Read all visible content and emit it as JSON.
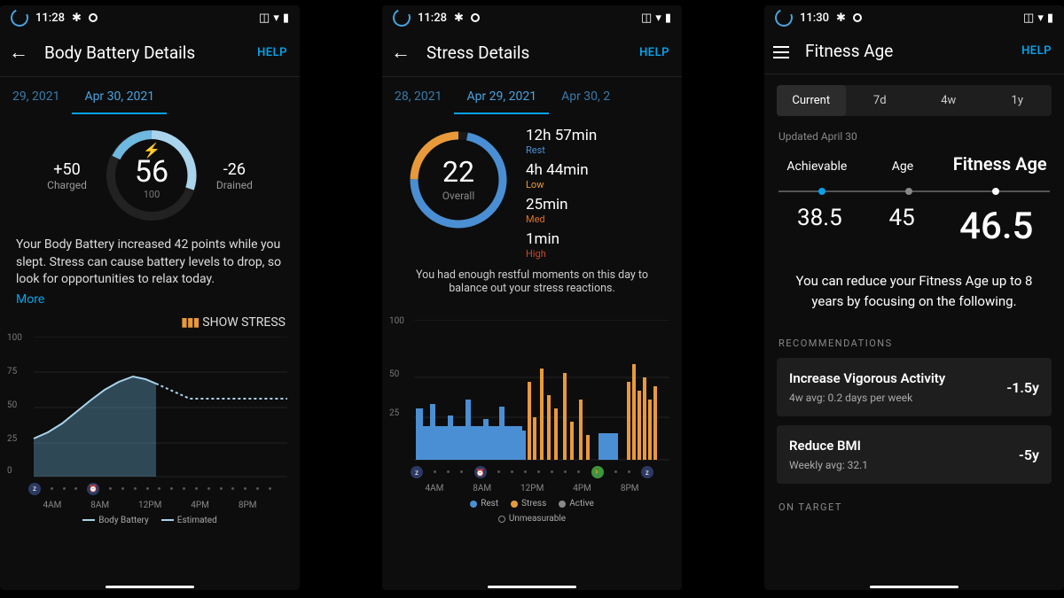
{
  "screen1": {
    "status": {
      "time": "11:28"
    },
    "title": "Body Battery Details",
    "help": "HELP",
    "date_prev": "29, 2021",
    "date_active": "Apr 30, 2021",
    "charged_label": "Charged",
    "charged_value": "+50",
    "drained_label": "Drained",
    "drained_value": "-26",
    "main_value": "56",
    "max_value": "100",
    "description": "Your Body Battery increased 42 points while you slept. Stress can cause battery levels to drop, so look for opportunities to relax today.",
    "more": "More",
    "show_stress": "SHOW STRESS",
    "xlabels": [
      "4AM",
      "8AM",
      "12PM",
      "4PM",
      "8PM"
    ],
    "legend1": "Body Battery",
    "legend2": "Estimated"
  },
  "screen2": {
    "status": {
      "time": "11:28"
    },
    "title": "Stress Details",
    "help": "HELP",
    "date_prev": "28, 2021",
    "date_active": "Apr 29, 2021",
    "date_next": "Apr 30, 2",
    "main_value": "22",
    "main_label": "Overall",
    "stats": [
      {
        "value": "12h 57min",
        "label": "Rest",
        "cls": "c-rest"
      },
      {
        "value": "4h 44min",
        "label": "Low",
        "cls": "c-low"
      },
      {
        "value": "25min",
        "label": "Med",
        "cls": "c-med"
      },
      {
        "value": "1min",
        "label": "High",
        "cls": "c-high"
      }
    ],
    "description": "You had enough restful moments on this day to balance out your stress reactions.",
    "xlabels": [
      "4AM",
      "8AM",
      "12PM",
      "4PM",
      "8PM"
    ],
    "legend": [
      "Rest",
      "Stress",
      "Active",
      "Unmeasurable"
    ]
  },
  "screen3": {
    "status": {
      "time": "11:30"
    },
    "title": "Fitness Age",
    "help": "HELP",
    "tabs": [
      "Current",
      "7d",
      "4w",
      "1y"
    ],
    "updated": "Updated April 30",
    "col1_label": "Achievable",
    "col2_label": "Age",
    "col3_label": "Fitness Age",
    "val_achievable": "38.5",
    "val_age": "45",
    "val_fitness": "46.5",
    "description": "You can reduce your Fitness Age up to 8 years by focusing on the following.",
    "section": "RECOMMENDATIONS",
    "cards": [
      {
        "title": "Increase Vigorous Activity",
        "sub": "4w avg: 0.2 days per week",
        "delta": "-1.5y"
      },
      {
        "title": "Reduce BMI",
        "sub": "Weekly avg: 32.1",
        "delta": "-5y"
      }
    ],
    "on_target": "ON TARGET"
  },
  "chart_data": [
    {
      "type": "area",
      "title": "Body Battery",
      "xlabel": "",
      "ylabel": "",
      "ylim": [
        0,
        100
      ],
      "x_hours": [
        0,
        1,
        2,
        3,
        4,
        5,
        6,
        7,
        8,
        9,
        10,
        11,
        12
      ],
      "values": [
        30,
        34,
        40,
        48,
        56,
        63,
        68,
        72,
        70,
        66,
        56,
        56,
        56
      ],
      "estimated_after_index": 9,
      "x_ticks": [
        "4AM",
        "8AM",
        "12PM",
        "4PM",
        "8PM"
      ]
    },
    {
      "type": "bar",
      "title": "Stress",
      "xlabel": "",
      "ylabel": "",
      "ylim": [
        0,
        100
      ],
      "x_ticks": [
        "4AM",
        "8AM",
        "12PM",
        "4PM",
        "8PM"
      ],
      "series": [
        {
          "name": "Rest",
          "color": "#4a8fd3",
          "approx_share": 0.72
        },
        {
          "name": "Stress",
          "color": "#e89a3a",
          "approx_share": 0.26
        },
        {
          "name": "Active",
          "color": "#888",
          "approx_share": 0.0
        },
        {
          "name": "Unmeasurable",
          "color": "#444",
          "approx_share": 0.02
        }
      ],
      "note": "dense minute-level bars; rest dominates overnight (~12AM-11AM), stress spikes ~12PM-4PM and ~8-9PM"
    }
  ]
}
